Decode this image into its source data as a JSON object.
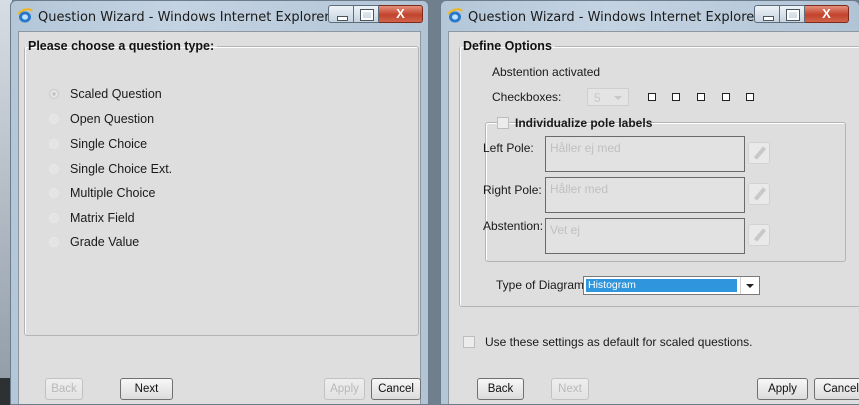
{
  "window_title": "Question Wizard - Windows Internet Explorer",
  "close_glyph": "X",
  "left": {
    "legend": "Please choose a question type:",
    "options": [
      "Scaled Question",
      "Open Question",
      "Single Choice",
      "Single Choice Ext.",
      "Multiple Choice",
      "Matrix Field",
      "Grade Value"
    ],
    "selected": "Scaled Question",
    "buttons": {
      "back": "Back",
      "next": "Next",
      "apply": "Apply",
      "cancel": "Cancel"
    }
  },
  "right": {
    "legend": "Define Options",
    "abstention_text": "Abstention activated",
    "checkboxes_label": "Checkboxes:",
    "checkboxes_value": "5",
    "individualize_label": "Individualize pole labels",
    "left_pole_label": "Left Pole:",
    "left_pole_value": "Håller ej med",
    "right_pole_label": "Right Pole:",
    "right_pole_value": "Håller med",
    "abstention_label": "Abstention:",
    "abstention_value": "Vet ej",
    "diagram_label": "Type of Diagram:",
    "diagram_value": "Histogram",
    "default_label": "Use these settings as default for scaled questions.",
    "buttons": {
      "back": "Back",
      "next": "Next",
      "apply": "Apply",
      "cancel": "Cancel"
    }
  }
}
